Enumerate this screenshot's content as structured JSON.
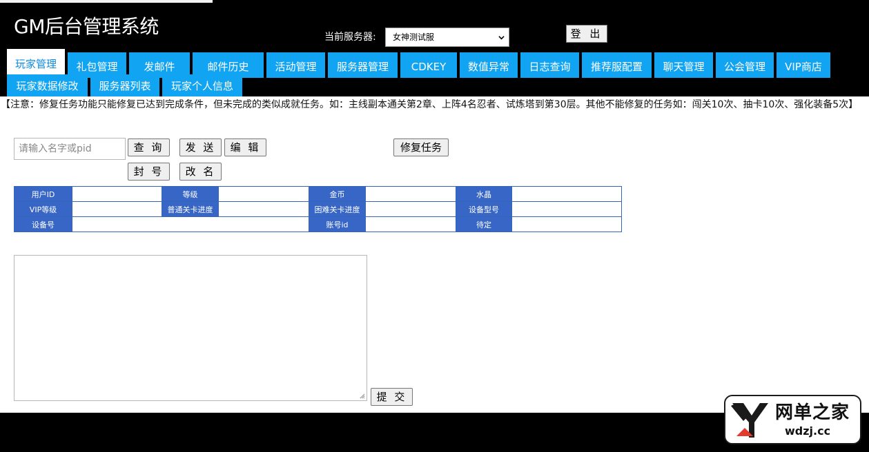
{
  "app": {
    "title": "GM后台管理系统"
  },
  "server": {
    "label": "当前服务器:",
    "selected": "女神测试服"
  },
  "header": {
    "logout_label": "登 出"
  },
  "tabs": [
    {
      "label": "玩家管理",
      "active": true
    },
    {
      "label": "礼包管理"
    },
    {
      "label": "发邮件"
    },
    {
      "label": "邮件历史"
    },
    {
      "label": "活动管理"
    },
    {
      "label": "服务器管理"
    },
    {
      "label": "CDKEY"
    },
    {
      "label": "数值异常"
    },
    {
      "label": "日志查询"
    },
    {
      "label": "推荐服配置"
    },
    {
      "label": "聊天管理"
    },
    {
      "label": "公会管理"
    },
    {
      "label": "VIP商店"
    },
    {
      "label": "玩家数据修改"
    },
    {
      "label": "服务器列表"
    },
    {
      "label": "玩家个人信息"
    }
  ],
  "notice": "【注意：修复任务功能只能修复已达到完成条件，但未完成的类似成就任务。如：主线副本通关第2章、上阵4名忍者、试炼塔到第30层。其他不能修复的任务如：闯关10次、抽卡10次、强化装备5次】",
  "search": {
    "placeholder": "请输入名字或pid"
  },
  "actions": {
    "query": "查 询",
    "send": "发 送",
    "edit": "编 辑",
    "fix_task": "修复任务",
    "ban": "封 号",
    "rename": "改 名",
    "submit": "提 交"
  },
  "info_table": {
    "rows": [
      [
        "用户ID",
        "",
        "等级",
        "",
        "金币",
        "",
        "水晶",
        ""
      ],
      [
        "VIP等级",
        "",
        "普通关卡进度",
        "",
        "困难关卡进度",
        "",
        "设备型号",
        ""
      ],
      [
        "设备号",
        "",
        "账号id",
        "",
        "待定",
        ""
      ]
    ]
  },
  "watermark": {
    "name": "网单之家",
    "domain": "wdzj.cc"
  },
  "colors": {
    "tab_bg": "#11a4f3",
    "tab_active_text": "#0a8be0",
    "table_header": "#3766c6"
  }
}
